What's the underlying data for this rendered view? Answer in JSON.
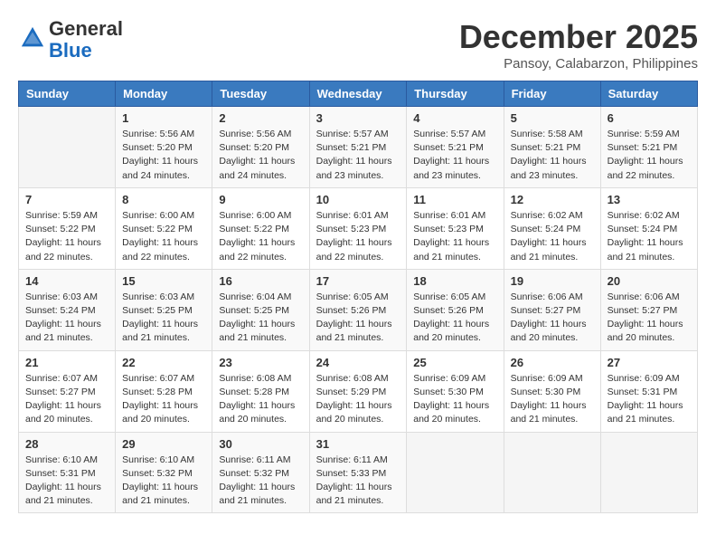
{
  "logo": {
    "general": "General",
    "blue": "Blue"
  },
  "header": {
    "month": "December 2025",
    "location": "Pansoy, Calabarzon, Philippines"
  },
  "days_of_week": [
    "Sunday",
    "Monday",
    "Tuesday",
    "Wednesday",
    "Thursday",
    "Friday",
    "Saturday"
  ],
  "weeks": [
    [
      {
        "day": "",
        "sunrise": "",
        "sunset": "",
        "daylight": ""
      },
      {
        "day": "1",
        "sunrise": "Sunrise: 5:56 AM",
        "sunset": "Sunset: 5:20 PM",
        "daylight": "Daylight: 11 hours and 24 minutes."
      },
      {
        "day": "2",
        "sunrise": "Sunrise: 5:56 AM",
        "sunset": "Sunset: 5:20 PM",
        "daylight": "Daylight: 11 hours and 24 minutes."
      },
      {
        "day": "3",
        "sunrise": "Sunrise: 5:57 AM",
        "sunset": "Sunset: 5:21 PM",
        "daylight": "Daylight: 11 hours and 23 minutes."
      },
      {
        "day": "4",
        "sunrise": "Sunrise: 5:57 AM",
        "sunset": "Sunset: 5:21 PM",
        "daylight": "Daylight: 11 hours and 23 minutes."
      },
      {
        "day": "5",
        "sunrise": "Sunrise: 5:58 AM",
        "sunset": "Sunset: 5:21 PM",
        "daylight": "Daylight: 11 hours and 23 minutes."
      },
      {
        "day": "6",
        "sunrise": "Sunrise: 5:59 AM",
        "sunset": "Sunset: 5:21 PM",
        "daylight": "Daylight: 11 hours and 22 minutes."
      }
    ],
    [
      {
        "day": "7",
        "sunrise": "Sunrise: 5:59 AM",
        "sunset": "Sunset: 5:22 PM",
        "daylight": "Daylight: 11 hours and 22 minutes."
      },
      {
        "day": "8",
        "sunrise": "Sunrise: 6:00 AM",
        "sunset": "Sunset: 5:22 PM",
        "daylight": "Daylight: 11 hours and 22 minutes."
      },
      {
        "day": "9",
        "sunrise": "Sunrise: 6:00 AM",
        "sunset": "Sunset: 5:22 PM",
        "daylight": "Daylight: 11 hours and 22 minutes."
      },
      {
        "day": "10",
        "sunrise": "Sunrise: 6:01 AM",
        "sunset": "Sunset: 5:23 PM",
        "daylight": "Daylight: 11 hours and 22 minutes."
      },
      {
        "day": "11",
        "sunrise": "Sunrise: 6:01 AM",
        "sunset": "Sunset: 5:23 PM",
        "daylight": "Daylight: 11 hours and 21 minutes."
      },
      {
        "day": "12",
        "sunrise": "Sunrise: 6:02 AM",
        "sunset": "Sunset: 5:24 PM",
        "daylight": "Daylight: 11 hours and 21 minutes."
      },
      {
        "day": "13",
        "sunrise": "Sunrise: 6:02 AM",
        "sunset": "Sunset: 5:24 PM",
        "daylight": "Daylight: 11 hours and 21 minutes."
      }
    ],
    [
      {
        "day": "14",
        "sunrise": "Sunrise: 6:03 AM",
        "sunset": "Sunset: 5:24 PM",
        "daylight": "Daylight: 11 hours and 21 minutes."
      },
      {
        "day": "15",
        "sunrise": "Sunrise: 6:03 AM",
        "sunset": "Sunset: 5:25 PM",
        "daylight": "Daylight: 11 hours and 21 minutes."
      },
      {
        "day": "16",
        "sunrise": "Sunrise: 6:04 AM",
        "sunset": "Sunset: 5:25 PM",
        "daylight": "Daylight: 11 hours and 21 minutes."
      },
      {
        "day": "17",
        "sunrise": "Sunrise: 6:05 AM",
        "sunset": "Sunset: 5:26 PM",
        "daylight": "Daylight: 11 hours and 21 minutes."
      },
      {
        "day": "18",
        "sunrise": "Sunrise: 6:05 AM",
        "sunset": "Sunset: 5:26 PM",
        "daylight": "Daylight: 11 hours and 20 minutes."
      },
      {
        "day": "19",
        "sunrise": "Sunrise: 6:06 AM",
        "sunset": "Sunset: 5:27 PM",
        "daylight": "Daylight: 11 hours and 20 minutes."
      },
      {
        "day": "20",
        "sunrise": "Sunrise: 6:06 AM",
        "sunset": "Sunset: 5:27 PM",
        "daylight": "Daylight: 11 hours and 20 minutes."
      }
    ],
    [
      {
        "day": "21",
        "sunrise": "Sunrise: 6:07 AM",
        "sunset": "Sunset: 5:27 PM",
        "daylight": "Daylight: 11 hours and 20 minutes."
      },
      {
        "day": "22",
        "sunrise": "Sunrise: 6:07 AM",
        "sunset": "Sunset: 5:28 PM",
        "daylight": "Daylight: 11 hours and 20 minutes."
      },
      {
        "day": "23",
        "sunrise": "Sunrise: 6:08 AM",
        "sunset": "Sunset: 5:28 PM",
        "daylight": "Daylight: 11 hours and 20 minutes."
      },
      {
        "day": "24",
        "sunrise": "Sunrise: 6:08 AM",
        "sunset": "Sunset: 5:29 PM",
        "daylight": "Daylight: 11 hours and 20 minutes."
      },
      {
        "day": "25",
        "sunrise": "Sunrise: 6:09 AM",
        "sunset": "Sunset: 5:30 PM",
        "daylight": "Daylight: 11 hours and 20 minutes."
      },
      {
        "day": "26",
        "sunrise": "Sunrise: 6:09 AM",
        "sunset": "Sunset: 5:30 PM",
        "daylight": "Daylight: 11 hours and 21 minutes."
      },
      {
        "day": "27",
        "sunrise": "Sunrise: 6:09 AM",
        "sunset": "Sunset: 5:31 PM",
        "daylight": "Daylight: 11 hours and 21 minutes."
      }
    ],
    [
      {
        "day": "28",
        "sunrise": "Sunrise: 6:10 AM",
        "sunset": "Sunset: 5:31 PM",
        "daylight": "Daylight: 11 hours and 21 minutes."
      },
      {
        "day": "29",
        "sunrise": "Sunrise: 6:10 AM",
        "sunset": "Sunset: 5:32 PM",
        "daylight": "Daylight: 11 hours and 21 minutes."
      },
      {
        "day": "30",
        "sunrise": "Sunrise: 6:11 AM",
        "sunset": "Sunset: 5:32 PM",
        "daylight": "Daylight: 11 hours and 21 minutes."
      },
      {
        "day": "31",
        "sunrise": "Sunrise: 6:11 AM",
        "sunset": "Sunset: 5:33 PM",
        "daylight": "Daylight: 11 hours and 21 minutes."
      },
      {
        "day": "",
        "sunrise": "",
        "sunset": "",
        "daylight": ""
      },
      {
        "day": "",
        "sunrise": "",
        "sunset": "",
        "daylight": ""
      },
      {
        "day": "",
        "sunrise": "",
        "sunset": "",
        "daylight": ""
      }
    ]
  ]
}
